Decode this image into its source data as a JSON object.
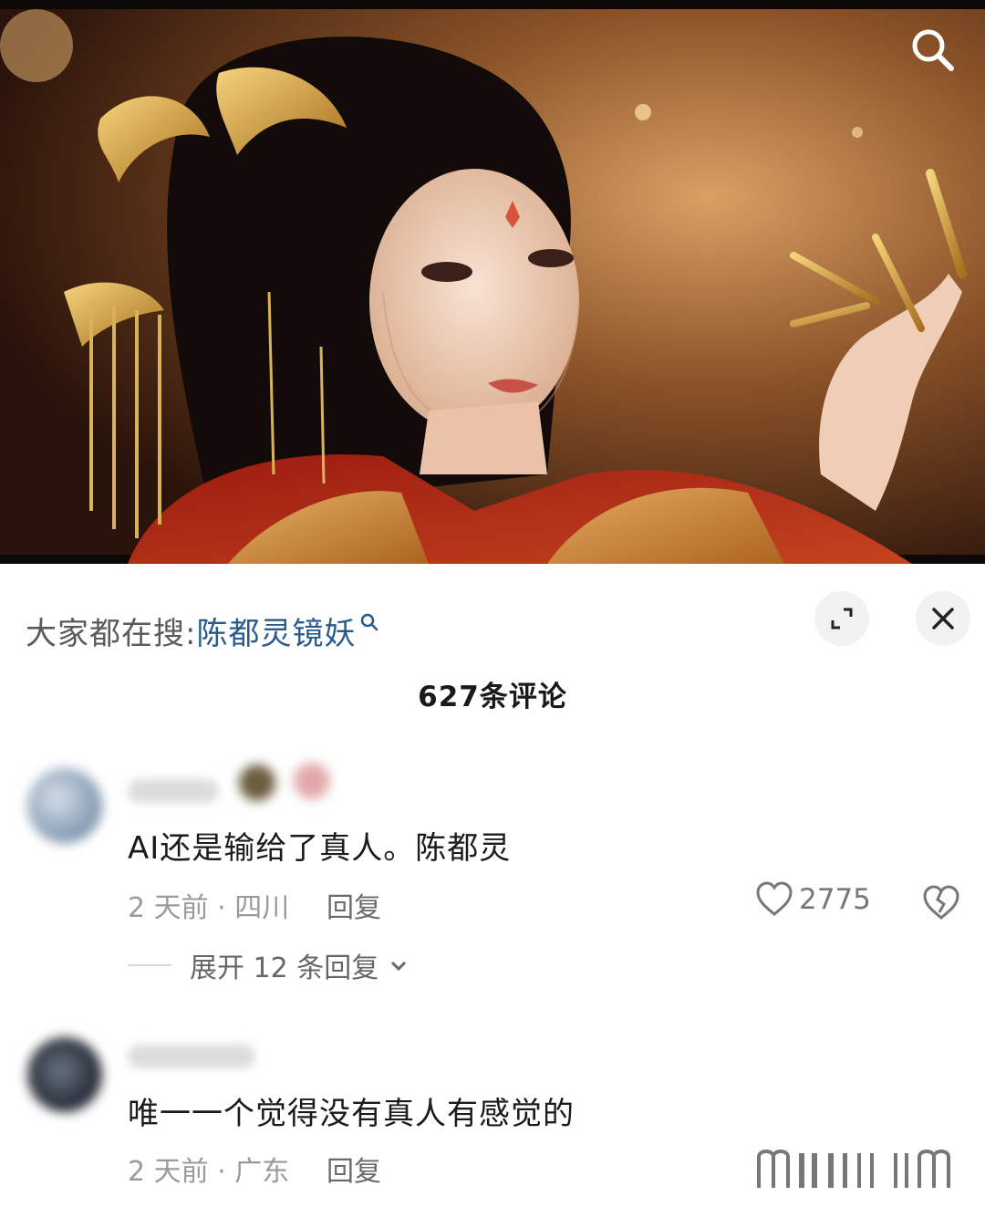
{
  "video": {
    "search_icon": "search-icon"
  },
  "search_bar": {
    "prefix": "大家都在搜:",
    "term": "陈都灵镜妖",
    "term_icon": "search-icon"
  },
  "controls": {
    "expand_icon": "expand-icon",
    "close_icon": "close-icon"
  },
  "comments_header": {
    "count_label": "627条评论"
  },
  "comments": [
    {
      "text": "AI还是输给了真人。陈都灵",
      "time_location": "2 天前 · 四川",
      "reply_label": "回复",
      "likes": "2775",
      "expand_replies_label": "展开 12 条回复"
    },
    {
      "text": "唯一一个觉得没有真人有感觉的",
      "time_location": "2 天前 · 广东",
      "reply_label": "回复"
    }
  ],
  "colors": {
    "accent_link": "#2a5b8c",
    "muted": "#9a9a9a",
    "background": "#ffffff"
  }
}
